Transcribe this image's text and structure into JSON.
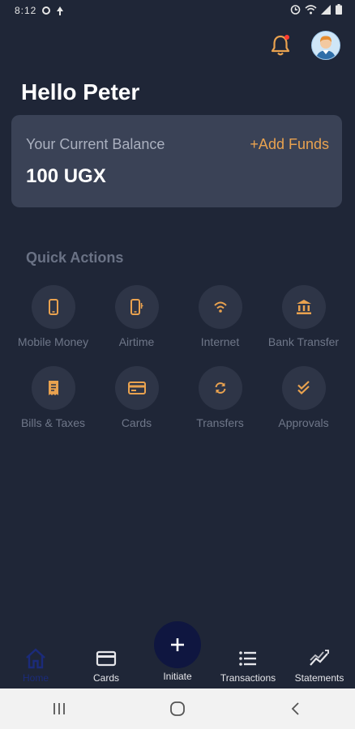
{
  "status_bar": {
    "time": "8:12"
  },
  "greeting": "Hello Peter",
  "balance": {
    "label": "Your Current Balance",
    "value": "100 UGX",
    "add_funds": "+Add Funds"
  },
  "quick_actions": {
    "title": "Quick Actions",
    "items": [
      {
        "label": "Mobile Money",
        "icon": "mobile-phone-icon"
      },
      {
        "label": "Airtime",
        "icon": "airtime-phone-icon"
      },
      {
        "label": "Internet",
        "icon": "wifi-icon"
      },
      {
        "label": "Bank Transfer",
        "icon": "bank-icon"
      },
      {
        "label": "Bills & Taxes",
        "icon": "receipt-icon"
      },
      {
        "label": "Cards",
        "icon": "credit-card-icon"
      },
      {
        "label": "Transfers",
        "icon": "sync-icon"
      },
      {
        "label": "Approvals",
        "icon": "double-check-icon"
      }
    ]
  },
  "bottom_nav": {
    "home": "Home",
    "cards": "Cards",
    "initiate": "Initiate",
    "transactions": "Transactions",
    "statements": "Statements",
    "active": "Home"
  },
  "colors": {
    "background": "#1f2637",
    "card": "#3a4256",
    "accent": "#e9a24f",
    "icon_circle": "#2e3547",
    "fab": "#0f1640"
  }
}
